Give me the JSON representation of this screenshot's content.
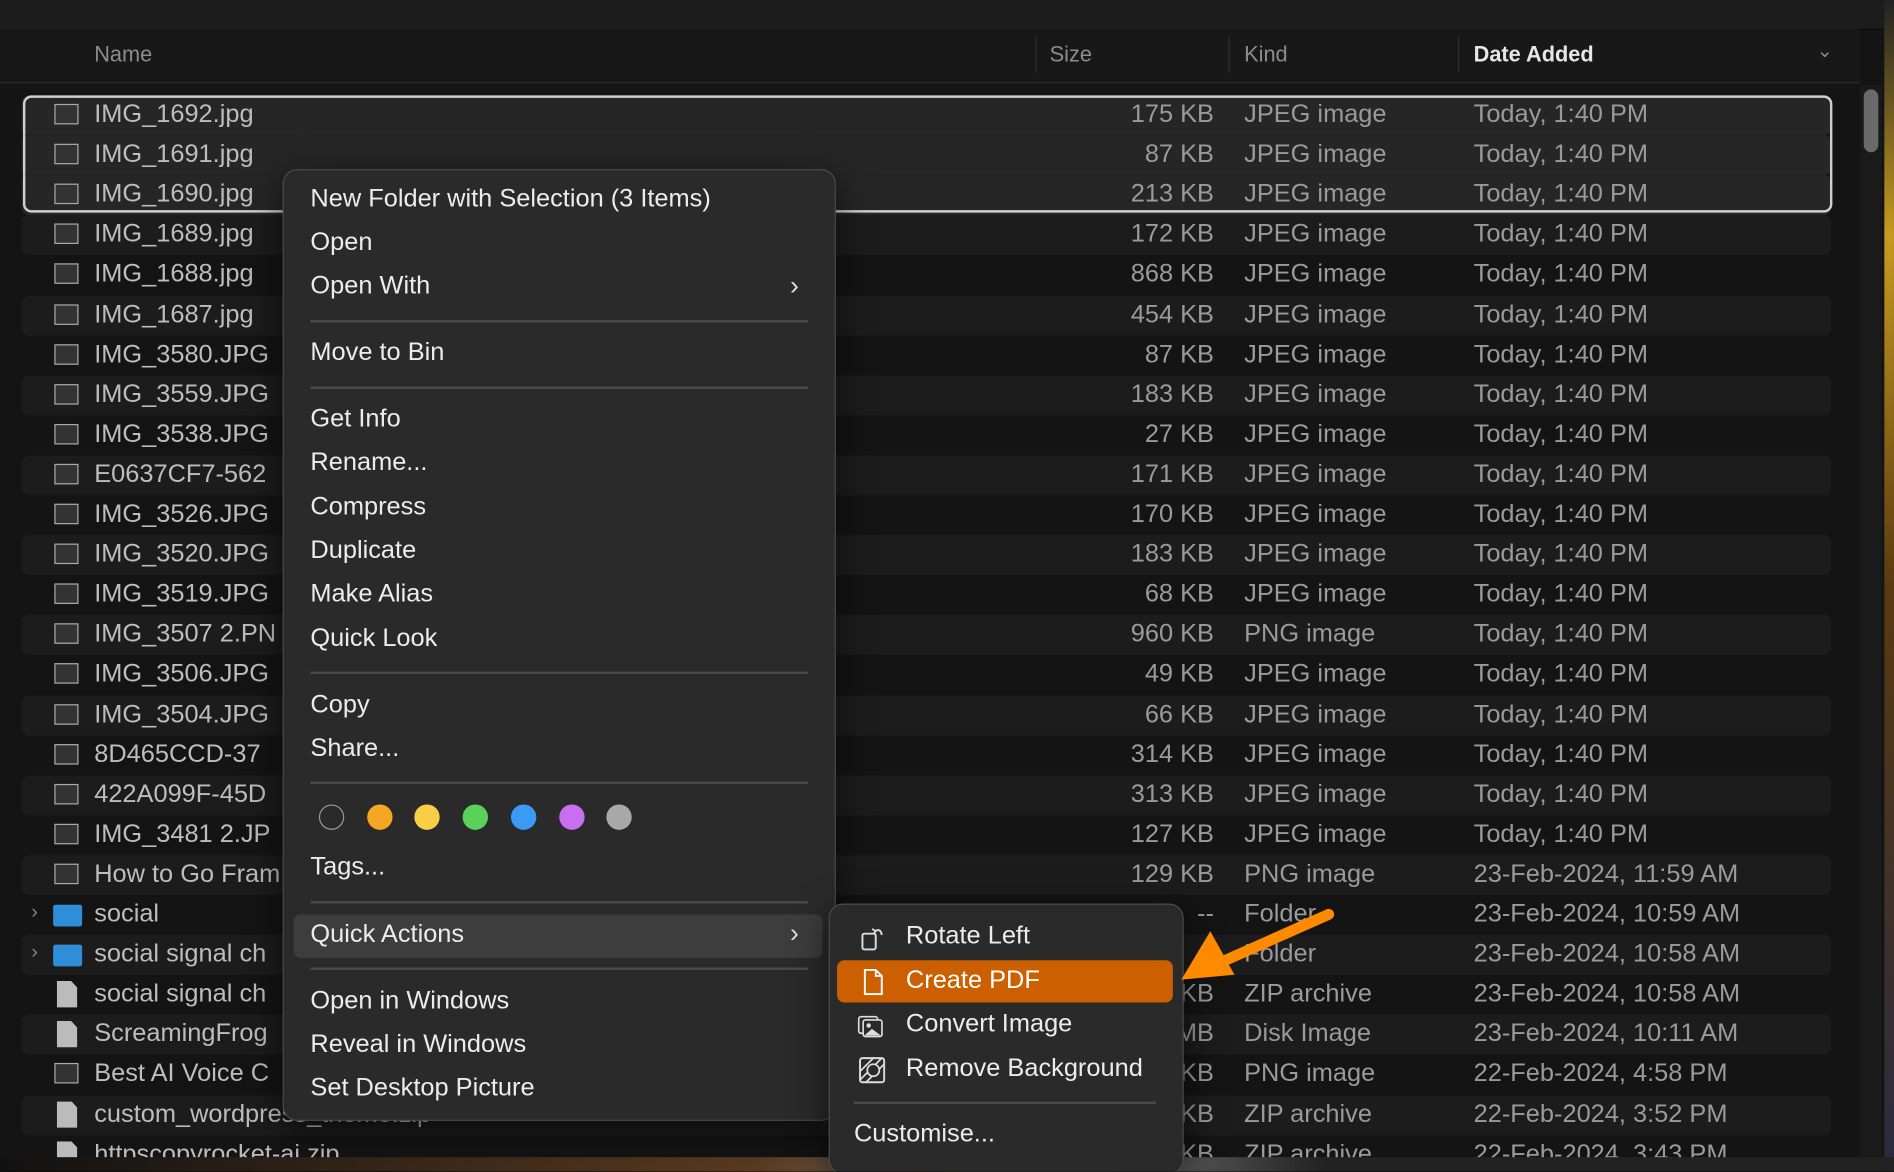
{
  "columns": {
    "name": "Name",
    "size": "Size",
    "kind": "Kind",
    "date": "Date Added"
  },
  "rows": [
    {
      "name": "IMG_1692.jpg",
      "size": "175 KB",
      "kind": "JPEG image",
      "date": "Today, 1:40 PM",
      "icon": "image",
      "selected": true
    },
    {
      "name": "IMG_1691.jpg",
      "size": "87 KB",
      "kind": "JPEG image",
      "date": "Today, 1:40 PM",
      "icon": "image",
      "selected": true
    },
    {
      "name": "IMG_1690.jpg",
      "size": "213 KB",
      "kind": "JPEG image",
      "date": "Today, 1:40 PM",
      "icon": "image",
      "selected": true
    },
    {
      "name": "IMG_1689.jpg",
      "size": "172 KB",
      "kind": "JPEG image",
      "date": "Today, 1:40 PM",
      "icon": "image"
    },
    {
      "name": "IMG_1688.jpg",
      "size": "868 KB",
      "kind": "JPEG image",
      "date": "Today, 1:40 PM",
      "icon": "image"
    },
    {
      "name": "IMG_1687.jpg",
      "size": "454 KB",
      "kind": "JPEG image",
      "date": "Today, 1:40 PM",
      "icon": "image"
    },
    {
      "name": "IMG_3580.JPG",
      "size": "87 KB",
      "kind": "JPEG image",
      "date": "Today, 1:40 PM",
      "icon": "image"
    },
    {
      "name": "IMG_3559.JPG",
      "size": "183 KB",
      "kind": "JPEG image",
      "date": "Today, 1:40 PM",
      "icon": "image"
    },
    {
      "name": "IMG_3538.JPG",
      "size": "27 KB",
      "kind": "JPEG image",
      "date": "Today, 1:40 PM",
      "icon": "image"
    },
    {
      "name": "E0637CF7-562",
      "size": "171 KB",
      "kind": "JPEG image",
      "date": "Today, 1:40 PM",
      "icon": "image"
    },
    {
      "name": "IMG_3526.JPG",
      "size": "170 KB",
      "kind": "JPEG image",
      "date": "Today, 1:40 PM",
      "icon": "image"
    },
    {
      "name": "IMG_3520.JPG",
      "size": "183 KB",
      "kind": "JPEG image",
      "date": "Today, 1:40 PM",
      "icon": "image"
    },
    {
      "name": "IMG_3519.JPG",
      "size": "68 KB",
      "kind": "JPEG image",
      "date": "Today, 1:40 PM",
      "icon": "image"
    },
    {
      "name": "IMG_3507 2.PN",
      "size": "960 KB",
      "kind": "PNG image",
      "date": "Today, 1:40 PM",
      "icon": "image"
    },
    {
      "name": "IMG_3506.JPG",
      "size": "49 KB",
      "kind": "JPEG image",
      "date": "Today, 1:40 PM",
      "icon": "image"
    },
    {
      "name": "IMG_3504.JPG",
      "size": "66 KB",
      "kind": "JPEG image",
      "date": "Today, 1:40 PM",
      "icon": "image"
    },
    {
      "name": "8D465CCD-37",
      "size": "314 KB",
      "kind": "JPEG image",
      "date": "Today, 1:40 PM",
      "icon": "image"
    },
    {
      "name": "422A099F-45D",
      "size": "313 KB",
      "kind": "JPEG image",
      "date": "Today, 1:40 PM",
      "icon": "image"
    },
    {
      "name": "IMG_3481 2.JP",
      "size": "127 KB",
      "kind": "JPEG image",
      "date": "Today, 1:40 PM",
      "icon": "image"
    },
    {
      "name": "How to Go Fram",
      "size": "129 KB",
      "kind": "PNG image",
      "date": "23-Feb-2024, 11:59 AM",
      "icon": "image"
    },
    {
      "name": "social",
      "size": "--",
      "kind": "Folder",
      "date": "23-Feb-2024, 10:59 AM",
      "icon": "folder"
    },
    {
      "name": "social signal ch",
      "size": "",
      "kind": "Folder",
      "date": "23-Feb-2024, 10:58 AM",
      "icon": "folder"
    },
    {
      "name": "social signal ch",
      "size": "KB",
      "kind": "ZIP archive",
      "date": "23-Feb-2024, 10:58 AM",
      "icon": "doc"
    },
    {
      "name": "ScreamingFrog",
      "size": "MB",
      "kind": "Disk Image",
      "date": "23-Feb-2024, 10:11 AM",
      "icon": "doc"
    },
    {
      "name": "Best AI Voice C",
      "size": "KB",
      "kind": "PNG image",
      "date": "22-Feb-2024, 4:58 PM",
      "icon": "image"
    },
    {
      "name": "custom_wordpress_theme.zip",
      "size": "KB",
      "kind": "ZIP archive",
      "date": "22-Feb-2024, 3:52 PM",
      "icon": "doc"
    },
    {
      "name": "httpscopyrocket-ai.zip",
      "size": "KB",
      "kind": "ZIP archive",
      "date": "22-Feb-2024, 3:43 PM",
      "icon": "doc"
    }
  ],
  "context_menu": {
    "new_folder": "New Folder with Selection (3 Items)",
    "open": "Open",
    "open_with": "Open With",
    "move_to_bin": "Move to Bin",
    "get_info": "Get Info",
    "rename": "Rename...",
    "compress": "Compress",
    "duplicate": "Duplicate",
    "make_alias": "Make Alias",
    "quick_look": "Quick Look",
    "copy": "Copy",
    "share": "Share...",
    "tag_colors": [
      "none",
      "#f5a623",
      "#f7ce46",
      "#5ad25a",
      "#3a9bf5",
      "#c86ef0",
      "#a8a8a8"
    ],
    "tags": "Tags...",
    "quick_actions": "Quick Actions",
    "open_in_windows": "Open in Windows",
    "reveal_in_windows": "Reveal in Windows",
    "set_desktop_picture": "Set Desktop Picture"
  },
  "submenu": {
    "rotate_left": "Rotate Left",
    "create_pdf": "Create PDF",
    "convert_image": "Convert Image",
    "remove_background": "Remove Background",
    "customise": "Customise..."
  },
  "colors": {
    "highlight": "#cc5f00",
    "arrow": "#ff8a00"
  }
}
